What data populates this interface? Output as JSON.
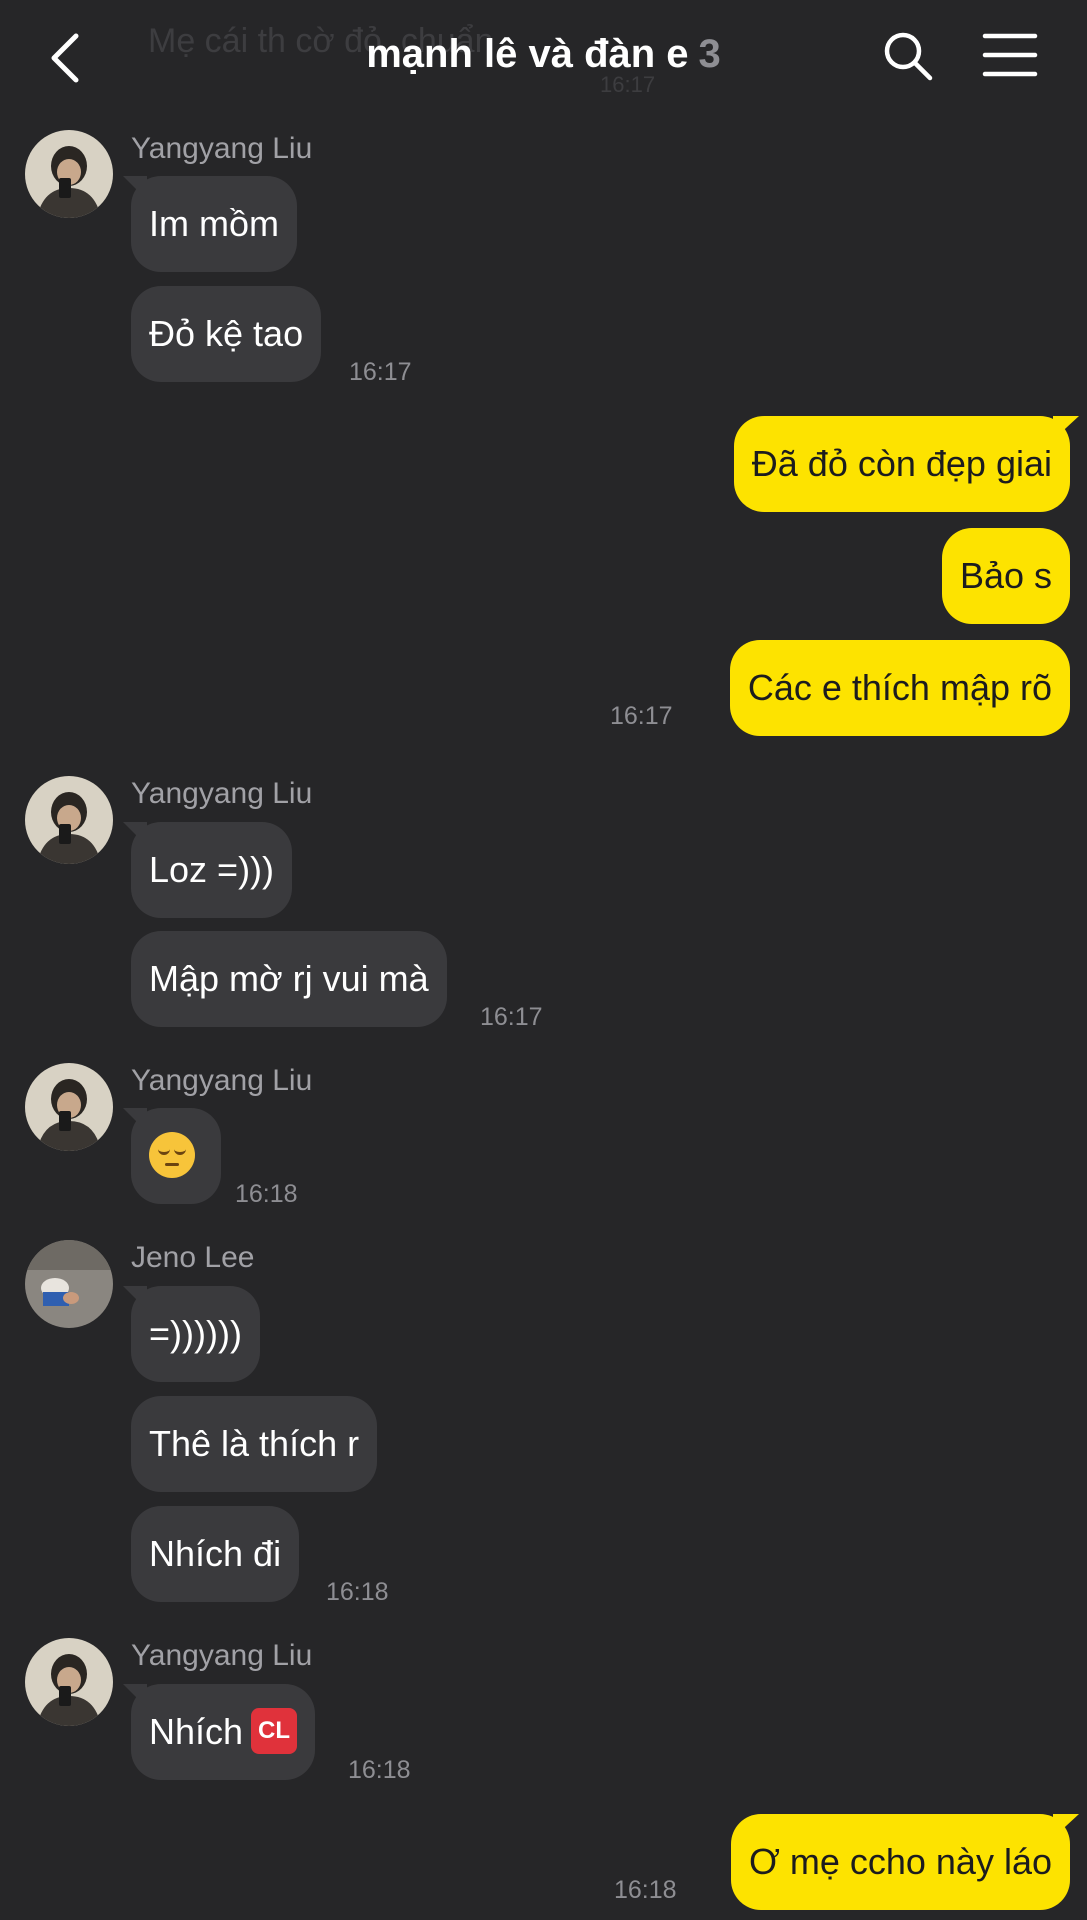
{
  "header": {
    "title": "mạnh lê và đàn e",
    "member_count": "3",
    "behind_message": "Mẹ cái th cờ đỏ, chuẩn",
    "behind_time": "16:17"
  },
  "icons": {
    "back": "chevron-left-icon",
    "search": "search-icon",
    "menu": "hamburger-menu-icon"
  },
  "colors": {
    "background": "#262628",
    "incoming_bubble": "#3a3a3d",
    "outgoing_bubble": "#fde300",
    "timestamp": "#8e8e93"
  },
  "messages": {
    "g1": {
      "sender": "Yangyang Liu",
      "b1": "Im mồm",
      "b2": "Đỏ kệ tao",
      "time": "16:17"
    },
    "g2": {
      "b1": "Đã đỏ còn đẹp giai",
      "b2": "Bảo s",
      "b3": "Các e thích mập rõ",
      "time": "16:17"
    },
    "g3": {
      "sender": "Yangyang Liu",
      "b1": "Loz =)))",
      "b2": "Mập mờ rj vui mà",
      "time": "16:17"
    },
    "g4": {
      "sender": "Yangyang Liu",
      "emoji": "pensive-face-emoji",
      "time": "16:18"
    },
    "g5": {
      "sender": "Jeno Lee",
      "b1": "=))))))",
      "b2": "Thê là thích r",
      "b3": "Nhích đi",
      "time": "16:18"
    },
    "g6": {
      "sender": "Yangyang Liu",
      "b1": "Nhích",
      "cl_badge": "CL",
      "time": "16:18"
    },
    "g7": {
      "b1": "Ơ mẹ ccho này láo",
      "time": "16:18"
    }
  }
}
